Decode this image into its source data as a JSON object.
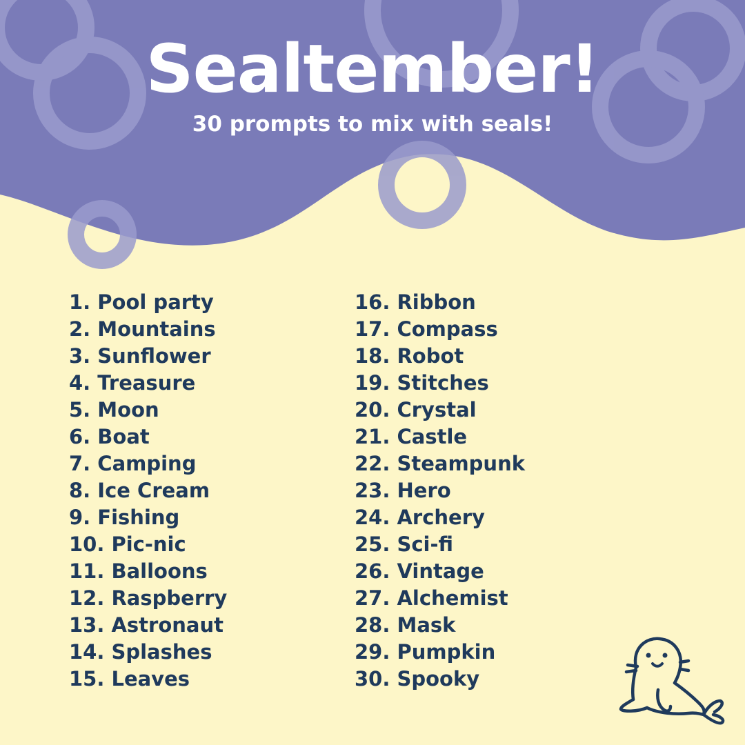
{
  "header": {
    "title": "Sealtember!",
    "subtitle": "30 prompts to mix with seals!"
  },
  "prompts": {
    "column1": [
      "1. Pool party",
      "2. Mountains",
      "3. Sunflower",
      "4. Treasure",
      "5. Moon",
      "6. Boat",
      "7. Camping",
      "8. Ice Cream",
      "9. Fishing",
      "10. Pic-nic",
      "11. Balloons",
      "12. Raspberry",
      "13. Astronaut",
      "14. Splashes",
      "15. Leaves"
    ],
    "column2": [
      "16. Ribbon",
      "17. Compass",
      "18. Robot",
      "19. Stitches",
      "20. Crystal",
      "21. Castle",
      "22. Steampunk",
      "23. Hero",
      "24. Archery",
      "25. Sci-fi",
      "26. Vintage",
      "27. Alchemist",
      "28. Mask",
      "29. Pumpkin",
      "30. Spooky"
    ]
  },
  "colors": {
    "header_background": "#7a7bb8",
    "page_background": "#fdf6c8",
    "text": "#1f3a5c",
    "bubble": "#9a9bcc"
  },
  "illustration": "seal-icon"
}
